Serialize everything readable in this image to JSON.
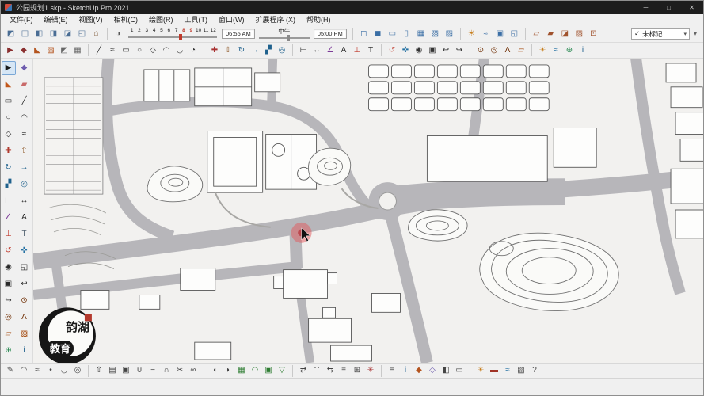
{
  "window": {
    "title": "公园规划1.skp - SketchUp Pro 2021",
    "controls": {
      "minimize": "─",
      "maximize": "□",
      "close": "✕"
    }
  },
  "menu": {
    "items": [
      "文件(F)",
      "编辑(E)",
      "视图(V)",
      "相机(C)",
      "绘图(R)",
      "工具(T)",
      "窗口(W)",
      "扩展程序 (X)",
      "帮助(H)"
    ]
  },
  "toolbar1": {
    "views": [
      {
        "name": "view-iso-icon",
        "glyph": "◩",
        "color": "#4a6d94"
      },
      {
        "name": "view-top-icon",
        "glyph": "◫",
        "color": "#4a6d94"
      },
      {
        "name": "view-front-icon",
        "glyph": "◧",
        "color": "#4a6d94"
      },
      {
        "name": "view-right-icon",
        "glyph": "◨",
        "color": "#4a6d94"
      },
      {
        "name": "view-back-icon",
        "glyph": "◪",
        "color": "#4a6d94"
      },
      {
        "name": "view-left-icon",
        "glyph": "◰",
        "color": "#4a6d94"
      },
      {
        "name": "view-home-icon",
        "glyph": "⌂",
        "color": "#7a5230"
      }
    ],
    "shadow": {
      "settings_icon": {
        "glyph": "◑"
      },
      "months": [
        {
          "label": "1"
        },
        {
          "label": "2"
        },
        {
          "label": "3"
        },
        {
          "label": "4"
        },
        {
          "label": "5"
        },
        {
          "label": "6"
        },
        {
          "label": "7"
        },
        {
          "label": "8",
          "red": true
        },
        {
          "label": "9",
          "red": true
        },
        {
          "label": "10"
        },
        {
          "label": "11"
        },
        {
          "label": "12"
        }
      ],
      "time_from": "06:55 AM",
      "noon_label": "中午",
      "time_to": "05:00 PM"
    },
    "styles": [
      {
        "name": "xray-style-icon",
        "glyph": "◻",
        "color": "#3a6ea5"
      },
      {
        "name": "back-edges-style-icon",
        "glyph": "◼",
        "color": "#3a6ea5"
      },
      {
        "name": "wireframe-style-icon",
        "glyph": "▭",
        "color": "#3a6ea5"
      },
      {
        "name": "hidden-line-style-icon",
        "glyph": "▯",
        "color": "#3a6ea5"
      },
      {
        "name": "shaded-style-icon",
        "glyph": "▦",
        "color": "#3a6ea5"
      },
      {
        "name": "textured-style-icon",
        "glyph": "▧",
        "color": "#3a6ea5"
      },
      {
        "name": "monochrome-style-icon",
        "glyph": "▨",
        "color": "#3a6ea5"
      }
    ],
    "shadow_toggles": [
      {
        "name": "shadows-toggle-icon",
        "glyph": "☀",
        "color": "#c77f1e"
      },
      {
        "name": "fog-toggle-icon",
        "glyph": "≈",
        "color": "#3a6ea5"
      },
      {
        "name": "photo-match-icon",
        "glyph": "▣",
        "color": "#3a6ea5"
      },
      {
        "name": "watermark-toggle-icon",
        "glyph": "◱",
        "color": "#3a6ea5"
      }
    ],
    "sections": [
      {
        "name": "section-plane-icon",
        "glyph": "▱",
        "color": "#a0522d"
      },
      {
        "name": "display-section-planes-icon",
        "glyph": "▰",
        "color": "#a0522d"
      },
      {
        "name": "display-section-cuts-icon",
        "glyph": "◪",
        "color": "#a0522d"
      },
      {
        "name": "section-fill-icon",
        "glyph": "▨",
        "color": "#a0522d"
      },
      {
        "name": "align-view-icon",
        "glyph": "⊡",
        "color": "#a0522d"
      }
    ],
    "tag_selector": {
      "check": "✓",
      "value": "未标记",
      "dropdown": "▾"
    },
    "overflow": "▾"
  },
  "toolbar2": {
    "icons": [
      {
        "name": "select-tool-icon",
        "glyph": "▶",
        "color": "#8a2f2f"
      },
      {
        "name": "component-tool-icon",
        "glyph": "◆",
        "color": "#8a2f2f"
      },
      {
        "name": "paint-tool-icon",
        "glyph": "◣",
        "color": "#b4541e"
      },
      {
        "name": "material-tool-icon",
        "glyph": "▨",
        "color": "#b4541e"
      },
      {
        "name": "style-tool-icon",
        "glyph": "◩",
        "color": "#666666"
      },
      {
        "name": "texture-tool-icon",
        "glyph": "▦",
        "color": "#666666"
      },
      {
        "sep": true
      },
      {
        "name": "line-tool-icon",
        "glyph": "╱",
        "color": "#333333"
      },
      {
        "name": "freehand-tool-icon",
        "glyph": "≈",
        "color": "#333333"
      },
      {
        "name": "rectangle-tool-icon",
        "glyph": "▭",
        "color": "#333333"
      },
      {
        "name": "circle-tool-icon",
        "glyph": "○",
        "color": "#333333"
      },
      {
        "name": "polygon-tool-icon",
        "glyph": "◇",
        "color": "#333333"
      },
      {
        "name": "arc-tool-icon",
        "glyph": "◠",
        "color": "#333333"
      },
      {
        "name": "two-point-arc-tool-icon",
        "glyph": "◡",
        "color": "#333333"
      },
      {
        "name": "pie-tool-icon",
        "glyph": "◔",
        "color": "#333333"
      },
      {
        "sep": true
      },
      {
        "name": "move-tool-icon",
        "glyph": "✚",
        "color": "#a83232"
      },
      {
        "name": "push-pull-tool-icon",
        "glyph": "⇧",
        "color": "#8d5524"
      },
      {
        "name": "rotate-tool-icon",
        "glyph": "↻",
        "color": "#1f618d"
      },
      {
        "name": "follow-me-tool-icon",
        "glyph": "→",
        "color": "#1f618d"
      },
      {
        "name": "scale-tool-icon",
        "glyph": "▞",
        "color": "#1f618d"
      },
      {
        "name": "offset-tool-icon",
        "glyph": "◎",
        "color": "#1f618d"
      },
      {
        "sep": true
      },
      {
        "name": "tape-measure-icon",
        "glyph": "⊢",
        "color": "#333333"
      },
      {
        "name": "dimension-icon",
        "glyph": "↔",
        "color": "#333333"
      },
      {
        "name": "protractor-icon",
        "glyph": "∠",
        "color": "#7d3c98"
      },
      {
        "name": "text-tool-icon",
        "glyph": "A",
        "color": "#333333"
      },
      {
        "name": "axes-tool-icon",
        "glyph": "⊥",
        "color": "#c0392b"
      },
      {
        "name": "threed-text-icon",
        "glyph": "T",
        "color": "#333333"
      },
      {
        "sep": true
      },
      {
        "name": "orbit-tool-icon",
        "glyph": "↺",
        "color": "#c0392b"
      },
      {
        "name": "pan-tool-icon",
        "glyph": "✜",
        "color": "#2471a3"
      },
      {
        "name": "zoom-tool-icon",
        "glyph": "◉",
        "color": "#333333"
      },
      {
        "name": "zoom-extents-icon",
        "glyph": "▣",
        "color": "#333333"
      },
      {
        "name": "previous-view-icon",
        "glyph": "↩",
        "color": "#333333"
      },
      {
        "name": "next-view-icon",
        "glyph": "↪",
        "color": "#333333"
      },
      {
        "sep": true
      },
      {
        "name": "position-camera-icon",
        "glyph": "⊙",
        "color": "#6e2c00"
      },
      {
        "name": "look-around-icon",
        "glyph": "◎",
        "color": "#6e2c00"
      },
      {
        "name": "walk-tool-icon",
        "glyph": "Λ",
        "color": "#6e2c00"
      },
      {
        "name": "section-plane-tool-icon",
        "glyph": "▱",
        "color": "#a04000"
      },
      {
        "sep": true
      },
      {
        "name": "shadows-dialog-icon",
        "glyph": "☀",
        "color": "#c77f1e"
      },
      {
        "name": "fog-dialog-icon",
        "glyph": "≈",
        "color": "#2471a3"
      },
      {
        "name": "add-location-icon",
        "glyph": "⊕",
        "color": "#1e8449"
      },
      {
        "name": "model-info-icon",
        "glyph": "i",
        "color": "#1f618d"
      }
    ]
  },
  "left_toolbar": {
    "icons": [
      {
        "name": "select-tool-icon",
        "glyph": "▶",
        "color": "#1a1a1a",
        "active": true
      },
      {
        "name": "make-component-icon",
        "glyph": "◆",
        "color": "#6d5bae"
      },
      {
        "name": "paint-bucket-icon",
        "glyph": "◣",
        "color": "#c2571a"
      },
      {
        "name": "eraser-tool-icon",
        "glyph": "▰",
        "color": "#c96a6a"
      },
      {
        "name": "rectangle-tool-icon",
        "glyph": "▭",
        "color": "#2a2a2a"
      },
      {
        "name": "line-tool-icon",
        "glyph": "╱",
        "color": "#2a2a2a"
      },
      {
        "name": "circle-tool-icon",
        "glyph": "○",
        "color": "#2a2a2a"
      },
      {
        "name": "arc-tool-icon",
        "glyph": "◠",
        "color": "#2a2a2a"
      },
      {
        "name": "polygon-tool-icon",
        "glyph": "◇",
        "color": "#2a2a2a"
      },
      {
        "name": "freehand-tool-icon",
        "glyph": "≈",
        "color": "#2a2a2a"
      },
      {
        "name": "move-tool-icon",
        "glyph": "✚",
        "color": "#b03a2e"
      },
      {
        "name": "push-pull-tool-icon",
        "glyph": "⇧",
        "color": "#8d5524"
      },
      {
        "name": "rotate-tool-icon",
        "glyph": "↻",
        "color": "#1f618d"
      },
      {
        "name": "follow-me-tool-icon",
        "glyph": "→",
        "color": "#1f618d"
      },
      {
        "name": "scale-tool-icon",
        "glyph": "▞",
        "color": "#1f618d"
      },
      {
        "name": "offset-tool-icon",
        "glyph": "◎",
        "color": "#1f618d"
      },
      {
        "name": "tape-measure-icon",
        "glyph": "⊢",
        "color": "#2a2a2a"
      },
      {
        "name": "dimension-tool-icon",
        "glyph": "↔",
        "color": "#2a2a2a"
      },
      {
        "name": "protractor-tool-icon",
        "glyph": "∠",
        "color": "#7d3c98"
      },
      {
        "name": "text-tool-icon",
        "glyph": "A",
        "color": "#2a2a2a"
      },
      {
        "name": "axes-tool-icon",
        "glyph": "⊥",
        "color": "#c0392b"
      },
      {
        "name": "threed-text-tool-icon",
        "glyph": "T",
        "color": "#566573"
      },
      {
        "name": "orbit-tool-icon",
        "glyph": "↺",
        "color": "#c0392b"
      },
      {
        "name": "pan-tool-icon",
        "glyph": "✜",
        "color": "#2471a3"
      },
      {
        "name": "zoom-tool-icon",
        "glyph": "◉",
        "color": "#2a2a2a"
      },
      {
        "name": "zoom-window-icon",
        "glyph": "◱",
        "color": "#2a2a2a"
      },
      {
        "name": "zoom-extents-icon",
        "glyph": "▣",
        "color": "#2a2a2a"
      },
      {
        "name": "previous-view-icon",
        "glyph": "↩",
        "color": "#2a2a2a"
      },
      {
        "name": "next-view-icon",
        "glyph": "↪",
        "color": "#2a2a2a"
      },
      {
        "name": "position-camera-icon",
        "glyph": "⊙",
        "color": "#6e2c00"
      },
      {
        "name": "look-around-icon",
        "glyph": "◎",
        "color": "#6e2c00"
      },
      {
        "name": "walk-tool-icon",
        "glyph": "Λ",
        "color": "#6e2c00"
      },
      {
        "name": "section-plane-icon",
        "glyph": "▱",
        "color": "#a04000"
      },
      {
        "name": "section-fill-icon",
        "glyph": "▨",
        "color": "#a04000"
      },
      {
        "name": "add-location-icon",
        "glyph": "⊕",
        "color": "#1e8449"
      },
      {
        "name": "model-info-icon",
        "glyph": "i",
        "color": "#1f618d"
      }
    ]
  },
  "bottom_toolbar": {
    "icons": [
      {
        "name": "pencil-ext-icon",
        "glyph": "✎",
        "color": "#444444"
      },
      {
        "name": "curve-ext-icon",
        "glyph": "◠",
        "color": "#444444"
      },
      {
        "name": "spline-ext-icon",
        "glyph": "≈",
        "color": "#444444"
      },
      {
        "name": "point-ext-icon",
        "glyph": "•",
        "color": "#444444"
      },
      {
        "name": "arc3d-ext-icon",
        "glyph": "◡",
        "color": "#444444"
      },
      {
        "name": "offset-ext-icon",
        "glyph": "◎",
        "color": "#444444"
      },
      {
        "sep": true
      },
      {
        "name": "extrude-ext-icon",
        "glyph": "⇧",
        "color": "#444444"
      },
      {
        "name": "loft-ext-icon",
        "glyph": "▤",
        "color": "#444444"
      },
      {
        "name": "shell-ext-icon",
        "glyph": "▣",
        "color": "#444444"
      },
      {
        "name": "union-ext-icon",
        "glyph": "∪",
        "color": "#444444"
      },
      {
        "name": "subtract-ext-icon",
        "glyph": "−",
        "color": "#444444"
      },
      {
        "name": "intersect-ext-icon",
        "glyph": "∩",
        "color": "#444444"
      },
      {
        "name": "trim-ext-icon",
        "glyph": "✂",
        "color": "#444444"
      },
      {
        "name": "weld-ext-icon",
        "glyph": "∞",
        "color": "#444444"
      },
      {
        "sep": true
      },
      {
        "name": "soften-ext-icon",
        "glyph": "◖",
        "color": "#444444"
      },
      {
        "name": "smooth-ext-icon",
        "glyph": "◗",
        "color": "#444444"
      },
      {
        "name": "sandbox-contours-icon",
        "glyph": "▦",
        "color": "#2e7d32"
      },
      {
        "name": "sandbox-smoove-icon",
        "glyph": "◠",
        "color": "#2e7d32"
      },
      {
        "name": "sandbox-stamp-icon",
        "glyph": "▣",
        "color": "#2e7d32"
      },
      {
        "name": "sandbox-drape-icon",
        "glyph": "▽",
        "color": "#2e7d32"
      },
      {
        "sep": true
      },
      {
        "name": "flip-ext-icon",
        "glyph": "⇄",
        "color": "#444444"
      },
      {
        "name": "array-ext-icon",
        "glyph": "∷",
        "color": "#444444"
      },
      {
        "name": "mirror-ext-icon",
        "glyph": "⇆",
        "color": "#444444"
      },
      {
        "name": "align-ext-icon",
        "glyph": "≡",
        "color": "#444444"
      },
      {
        "name": "group-ext-icon",
        "glyph": "⊞",
        "color": "#444444"
      },
      {
        "name": "explode-ext-icon",
        "glyph": "✳",
        "color": "#a83232"
      },
      {
        "sep": true
      },
      {
        "name": "outliner-panel-icon",
        "glyph": "≡",
        "color": "#444444"
      },
      {
        "name": "entity-info-icon",
        "glyph": "i",
        "color": "#1f618d"
      },
      {
        "name": "materials-panel-icon",
        "glyph": "◆",
        "color": "#b4541e"
      },
      {
        "name": "components-panel-icon",
        "glyph": "◇",
        "color": "#6d5bae"
      },
      {
        "name": "styles-panel-icon",
        "glyph": "◧",
        "color": "#444444"
      },
      {
        "name": "scenes-panel-icon",
        "glyph": "▭",
        "color": "#444444"
      },
      {
        "sep": true
      },
      {
        "name": "shadows-panel-icon",
        "glyph": "☀",
        "color": "#c77f1e"
      },
      {
        "name": "red-extension-icon",
        "glyph": "▬",
        "color": "#a03326"
      },
      {
        "name": "fog-panel-icon",
        "glyph": "≈",
        "color": "#2471a3"
      },
      {
        "name": "match-photo-panel-icon",
        "glyph": "▨",
        "color": "#444444"
      },
      {
        "name": "instructor-panel-icon",
        "glyph": "?",
        "color": "#444444"
      }
    ]
  },
  "canvas": {
    "watermark": {
      "line1": "韵湖",
      "line2": "教育"
    }
  },
  "status_bar": {
    "text": ""
  }
}
